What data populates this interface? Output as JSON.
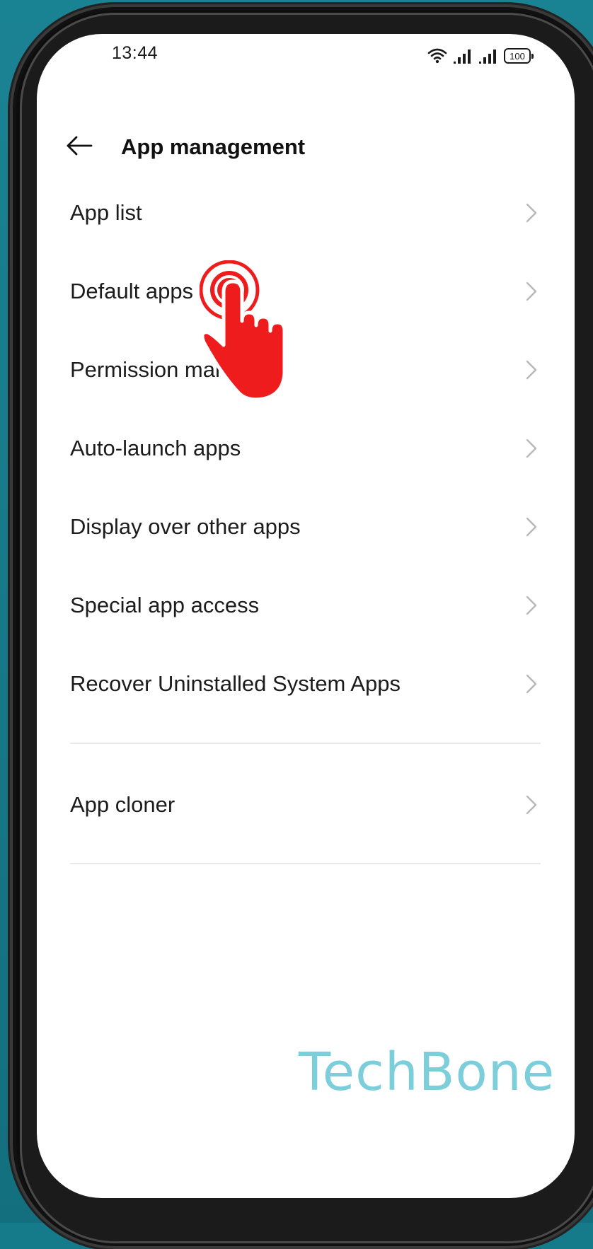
{
  "status_bar": {
    "time": "13:44",
    "battery": "100",
    "icons": [
      "wifi-icon",
      "signal-icon",
      "signal-icon",
      "battery-icon"
    ]
  },
  "header": {
    "title": "App management",
    "back_icon": "arrow-left-icon"
  },
  "menu": {
    "group1": [
      {
        "label": "App list"
      },
      {
        "label": "Default apps"
      },
      {
        "label": "Permission manager"
      },
      {
        "label": "Auto-launch apps"
      },
      {
        "label": "Display over other apps"
      },
      {
        "label": "Special app access"
      },
      {
        "label": "Recover Uninstalled System Apps"
      }
    ],
    "group2": [
      {
        "label": "App cloner"
      }
    ],
    "chevron_icon": "chevron-right-icon"
  },
  "overlay": {
    "tap_icon": "tap-hand-icon",
    "color": "#ee1c1c"
  },
  "watermark": "TechBone",
  "colors": {
    "background": "#157a8a",
    "screen": "#ffffff",
    "text": "#1c1c1c",
    "chevron": "#b8b8b8",
    "divider": "#e9e9e9",
    "watermark": "#7ccfda"
  }
}
